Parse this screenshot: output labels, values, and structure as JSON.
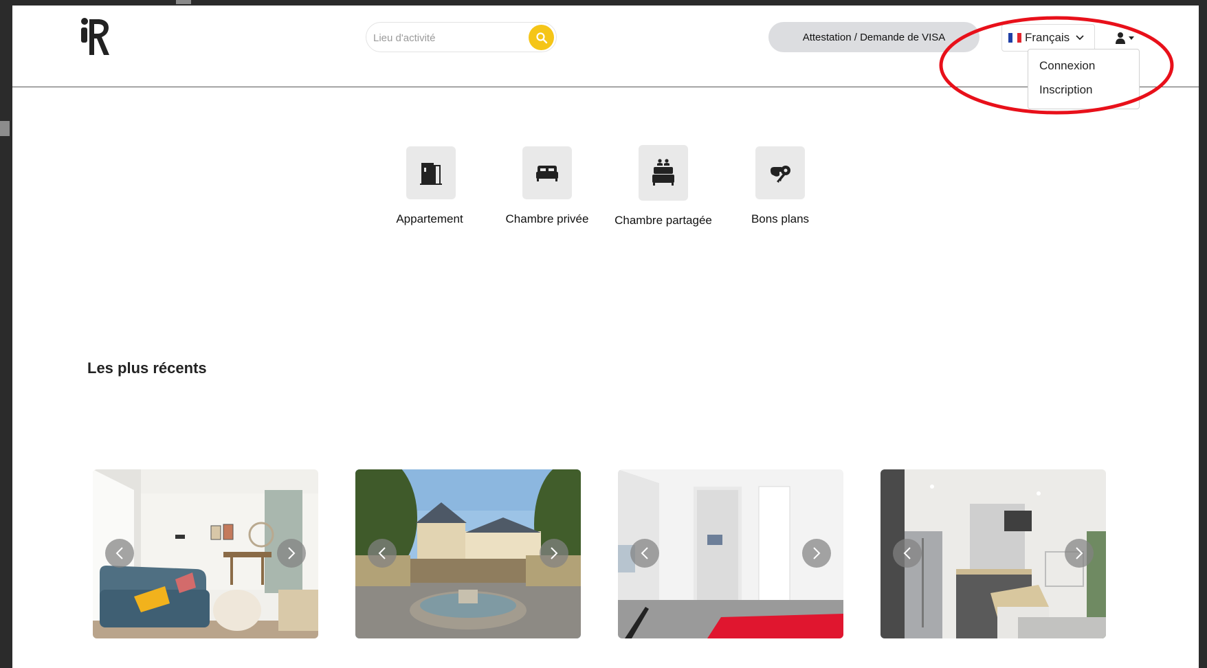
{
  "header": {
    "logo_alt": "iR",
    "search": {
      "placeholder": "Lieu d'activité",
      "value": ""
    },
    "visa_button_label": "Attestation / Demande de VISA",
    "language": {
      "selected": "Français",
      "flag": "fr-flag"
    },
    "user_menu": {
      "icon": "user-icon",
      "items": [
        {
          "label": "Connexion"
        },
        {
          "label": "Inscription"
        }
      ]
    }
  },
  "categories": [
    {
      "label": "Appartement",
      "icon": "door-icon"
    },
    {
      "label": "Chambre privée",
      "icon": "bed-icon"
    },
    {
      "label": "Chambre partagée",
      "icon": "shared-bed-icon"
    },
    {
      "label": "Bons plans",
      "icon": "hand-key-icon"
    }
  ],
  "recent": {
    "title": "Les plus récents",
    "listings": [
      {
        "photo": "living-room-photo"
      },
      {
        "photo": "city-fountain-photo"
      },
      {
        "photo": "bedroom-photo"
      },
      {
        "photo": "kitchen-photo"
      }
    ]
  },
  "colors": {
    "accent_yellow": "#f5c518",
    "annotation_red": "#e8101a",
    "pill_gray": "#dcdde0"
  }
}
